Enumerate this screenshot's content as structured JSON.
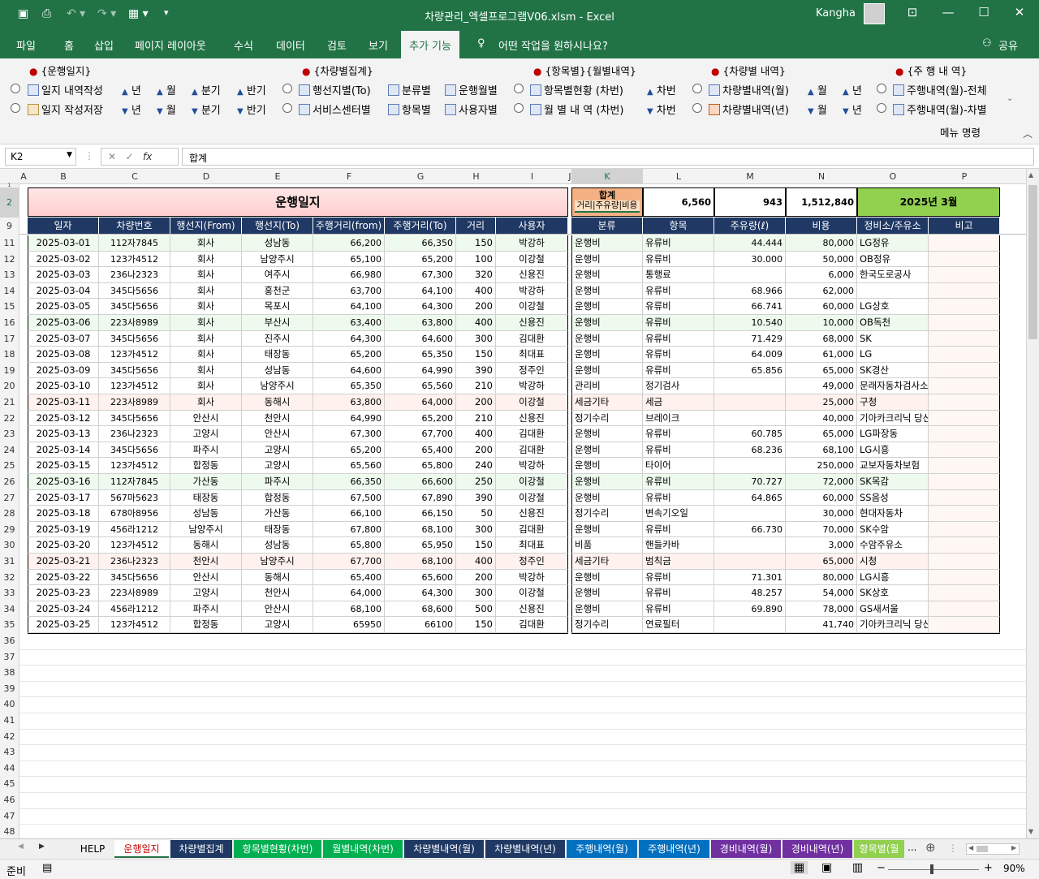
{
  "window": {
    "title": "차량관리_엑셀프로그램V06.xlsm  -  Excel",
    "user": "Kangha"
  },
  "tabs": [
    "파일",
    "홈",
    "삽입",
    "페이지 레이아웃",
    "수식",
    "데이터",
    "검토",
    "보기",
    "추가 기능"
  ],
  "tell_me": "어떤 작업을 원하시나요?",
  "share": "공유",
  "ribbon": {
    "groups": [
      "{운행일지}",
      "{차량별집계}",
      "{항목별}{월별내역}",
      "{차량별 내역}",
      "{주 행 내 역}"
    ],
    "g1_row1": [
      "일지 내역작성",
      "년",
      "월",
      "분기",
      "반기"
    ],
    "g1_row2": [
      "일지 작성저장",
      "년",
      "월",
      "분기",
      "반기"
    ],
    "g2_row1": [
      "행선지별(To)",
      "분류별",
      "운행월별"
    ],
    "g2_row2": [
      "서비스센터별",
      "항목별",
      "사용자별"
    ],
    "g3_row1": [
      "항목별현황 (차번)",
      "차번"
    ],
    "g3_row2": [
      "월 별 내 역 (차번)",
      "차번"
    ],
    "g4_row1": [
      "차량별내역(월)",
      "월",
      "년"
    ],
    "g4_row2": [
      "차량별내역(년)",
      "월",
      "년"
    ],
    "g5_row1": [
      "주행내역(월)-전체"
    ],
    "g5_row2": [
      "주행내역(월)-차별"
    ],
    "footer": "메뉴 명령"
  },
  "formula": {
    "namebox": "K2",
    "value": "합계"
  },
  "columns": [
    "A",
    "B",
    "C",
    "D",
    "E",
    "F",
    "G",
    "H",
    "I",
    "J",
    "K",
    "L",
    "M",
    "N",
    "O",
    "P"
  ],
  "row_numbers": [
    "1",
    "2",
    "9",
    "11",
    "12",
    "13",
    "14",
    "15",
    "16",
    "17",
    "18",
    "19",
    "20",
    "21",
    "22",
    "23",
    "24",
    "25",
    "26",
    "27",
    "28",
    "29",
    "30",
    "31",
    "32",
    "33",
    "34",
    "35",
    "36",
    "37",
    "38",
    "39",
    "40",
    "41",
    "42",
    "43",
    "44",
    "45",
    "46",
    "47",
    "48"
  ],
  "sheet_title": "운행일지",
  "summary": {
    "label1": "합계",
    "label2": "거리|주유량|비용",
    "distance": "6,560",
    "fuel": "943",
    "cost": "1,512,840",
    "period": "2025년 3월"
  },
  "left_headers": [
    "일자",
    "차량번호",
    "행선지(From)",
    "행선지(To)",
    "주행거리(from)",
    "주행거리(To)",
    "거리",
    "사용자"
  ],
  "right_headers": [
    "분류",
    "항목",
    "주유량(ℓ)",
    "비용",
    "정비소/주유소",
    "비고"
  ],
  "rows": [
    [
      "2025-03-01",
      "112자7845",
      "회사",
      "성남동",
      "66,200",
      "66,350",
      "150",
      "박강하",
      "운행비",
      "유류비",
      "44.444",
      "80,000",
      "LG정유",
      ""
    ],
    [
      "2025-03-02",
      "123가4512",
      "회사",
      "남양주시",
      "65,100",
      "65,200",
      "100",
      "이강철",
      "운행비",
      "유류비",
      "30.000",
      "50,000",
      "OB정유",
      ""
    ],
    [
      "2025-03-03",
      "236나2323",
      "회사",
      "여주시",
      "66,980",
      "67,300",
      "320",
      "신용진",
      "운행비",
      "통행료",
      "",
      "6,000",
      "한국도로공사",
      ""
    ],
    [
      "2025-03-04",
      "345다5656",
      "회사",
      "홍천군",
      "63,700",
      "64,100",
      "400",
      "박강하",
      "운행비",
      "유류비",
      "68.966",
      "62,000",
      "",
      ""
    ],
    [
      "2025-03-05",
      "345다5656",
      "회사",
      "목포시",
      "64,100",
      "64,300",
      "200",
      "이강철",
      "운행비",
      "유류비",
      "66.741",
      "60,000",
      "LG상호",
      ""
    ],
    [
      "2025-03-06",
      "223사8989",
      "회사",
      "부산시",
      "63,400",
      "63,800",
      "400",
      "신용진",
      "운행비",
      "유류비",
      "10.540",
      "10,000",
      "OB독천",
      ""
    ],
    [
      "2025-03-07",
      "345다5656",
      "회사",
      "진주시",
      "64,300",
      "64,600",
      "300",
      "김대환",
      "운행비",
      "유류비",
      "71.429",
      "68,000",
      "SK",
      ""
    ],
    [
      "2025-03-08",
      "123가4512",
      "회사",
      "태장동",
      "65,200",
      "65,350",
      "150",
      "최대표",
      "운행비",
      "유류비",
      "64.009",
      "61,000",
      "LG",
      ""
    ],
    [
      "2025-03-09",
      "345다5656",
      "회사",
      "성남동",
      "64,600",
      "64,990",
      "390",
      "정주인",
      "운행비",
      "유류비",
      "65.856",
      "65,000",
      "SK경산",
      ""
    ],
    [
      "2025-03-10",
      "123가4512",
      "회사",
      "남양주시",
      "65,350",
      "65,560",
      "210",
      "박강하",
      "관리비",
      "정기검사",
      "",
      "49,000",
      "문래자동차검사소",
      ""
    ],
    [
      "2025-03-11",
      "223사8989",
      "회사",
      "동해시",
      "63,800",
      "64,000",
      "200",
      "이강철",
      "세금기타",
      "세금",
      "",
      "25,000",
      "구청",
      ""
    ],
    [
      "2025-03-12",
      "345다5656",
      "안산시",
      "천안시",
      "64,990",
      "65,200",
      "210",
      "신용진",
      "정기수리",
      "브레이크",
      "",
      "40,000",
      "기아카크리닉 당산점",
      ""
    ],
    [
      "2025-03-13",
      "236나2323",
      "고양시",
      "안산시",
      "67,300",
      "67,700",
      "400",
      "김대환",
      "운행비",
      "유류비",
      "60.785",
      "65,000",
      "LG파장동",
      ""
    ],
    [
      "2025-03-14",
      "345다5656",
      "파주시",
      "고양시",
      "65,200",
      "65,400",
      "200",
      "김대환",
      "운행비",
      "유류비",
      "68.236",
      "68,100",
      "LG시흥",
      ""
    ],
    [
      "2025-03-15",
      "123가4512",
      "합정동",
      "고양시",
      "65,560",
      "65,800",
      "240",
      "박강하",
      "운행비",
      "타이어",
      "",
      "250,000",
      "교보자동차보험",
      ""
    ],
    [
      "2025-03-16",
      "112자7845",
      "가산동",
      "파주시",
      "66,350",
      "66,600",
      "250",
      "이강철",
      "운행비",
      "유류비",
      "70.727",
      "72,000",
      "SK목감",
      ""
    ],
    [
      "2025-03-17",
      "567마5623",
      "태장동",
      "합정동",
      "67,500",
      "67,890",
      "390",
      "이강철",
      "운행비",
      "유류비",
      "64.865",
      "60,000",
      "SS음성",
      ""
    ],
    [
      "2025-03-18",
      "678아8956",
      "성남동",
      "가산동",
      "66,100",
      "66,150",
      "50",
      "신용진",
      "정기수리",
      "변속기오일",
      "",
      "30,000",
      "현대자동차",
      ""
    ],
    [
      "2025-03-19",
      "456라1212",
      "남양주시",
      "태장동",
      "67,800",
      "68,100",
      "300",
      "김대환",
      "운행비",
      "유류비",
      "66.730",
      "70,000",
      "SK수암",
      ""
    ],
    [
      "2025-03-20",
      "123가4512",
      "동해시",
      "성남동",
      "65,800",
      "65,950",
      "150",
      "최대표",
      "비품",
      "핸들카바",
      "",
      "3,000",
      "수암주유소",
      ""
    ],
    [
      "2025-03-21",
      "236나2323",
      "천안시",
      "남양주시",
      "67,700",
      "68,100",
      "400",
      "정주인",
      "세금기타",
      "범칙금",
      "",
      "65,000",
      "시청",
      ""
    ],
    [
      "2025-03-22",
      "345다5656",
      "안산시",
      "동해시",
      "65,400",
      "65,600",
      "200",
      "박강하",
      "운행비",
      "유류비",
      "71.301",
      "80,000",
      "LG시흥",
      ""
    ],
    [
      "2025-03-23",
      "223사8989",
      "고양시",
      "천안시",
      "64,000",
      "64,300",
      "300",
      "이강철",
      "운행비",
      "유류비",
      "48.257",
      "54,000",
      "SK상호",
      ""
    ],
    [
      "2025-03-24",
      "456라1212",
      "파주시",
      "안산시",
      "68,100",
      "68,600",
      "500",
      "신용진",
      "운행비",
      "유류비",
      "69.890",
      "78,000",
      "GS새서울",
      ""
    ],
    [
      "2025-03-25",
      "123가4512",
      "합정동",
      "고양시",
      "65950",
      "66100",
      "150",
      "김대환",
      "정기수리",
      "연료필터",
      "",
      "41,740",
      "기아카크리닉 당산점",
      ""
    ]
  ],
  "sheet_tabs": [
    {
      "label": "HELP",
      "bg": "#f0f0f0",
      "fg": "#000000"
    },
    {
      "label": "운행일지",
      "bg": "#ffffff",
      "fg": "#c00000"
    },
    {
      "label": "차량별집계",
      "bg": "#1f3864",
      "fg": "#ffffff"
    },
    {
      "label": "항목별현황(차번)",
      "bg": "#00b050",
      "fg": "#ffffff"
    },
    {
      "label": "월별내역(차번)",
      "bg": "#00b050",
      "fg": "#ffffff"
    },
    {
      "label": "차량별내역(월)",
      "bg": "#1f3864",
      "fg": "#ffffff"
    },
    {
      "label": "차량별내역(년)",
      "bg": "#1f3864",
      "fg": "#ffffff"
    },
    {
      "label": "주행내역(월)",
      "bg": "#0070c0",
      "fg": "#ffffff"
    },
    {
      "label": "주행내역(년)",
      "bg": "#0070c0",
      "fg": "#ffffff"
    },
    {
      "label": "경비내역(월)",
      "bg": "#7030a0",
      "fg": "#ffffff"
    },
    {
      "label": "경비내역(년)",
      "bg": "#7030a0",
      "fg": "#ffffff"
    },
    {
      "label": "항목별(월",
      "bg": "#92d050",
      "fg": "#ffffff"
    }
  ],
  "status": {
    "ready": "준비",
    "zoom": "90%"
  },
  "colors": {
    "excel_green": "#217346",
    "header_navy": "#1f3864",
    "title_pink": "#ffd9d9",
    "period_green": "#92d050",
    "summary_orange": "#f4b183",
    "stripe_pink": "#fff2ee",
    "stripe_green": "#eefaee"
  }
}
